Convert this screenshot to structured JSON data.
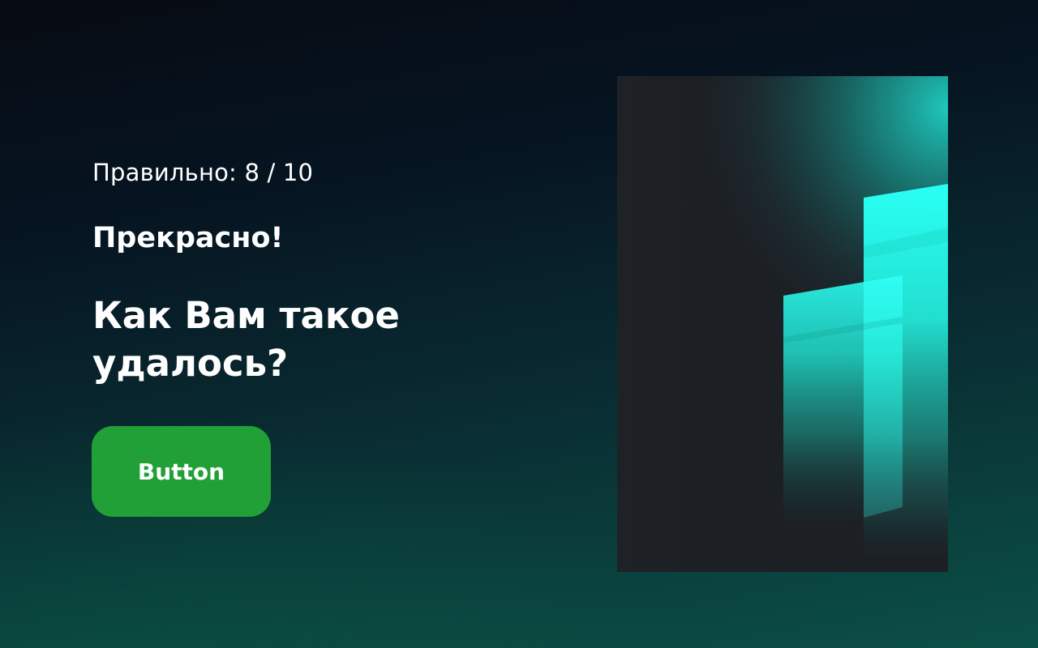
{
  "result": {
    "score_label": "Правильно: 8 / 10",
    "praise": "Прекрасно!",
    "question": "Как Вам такое удалось?"
  },
  "action": {
    "button_label": "Button"
  },
  "colors": {
    "button_bg": "#21a038",
    "text": "#ffffff",
    "accent": "#27fff0"
  },
  "illustration": {
    "icon": "teal-glass-bars-image"
  }
}
